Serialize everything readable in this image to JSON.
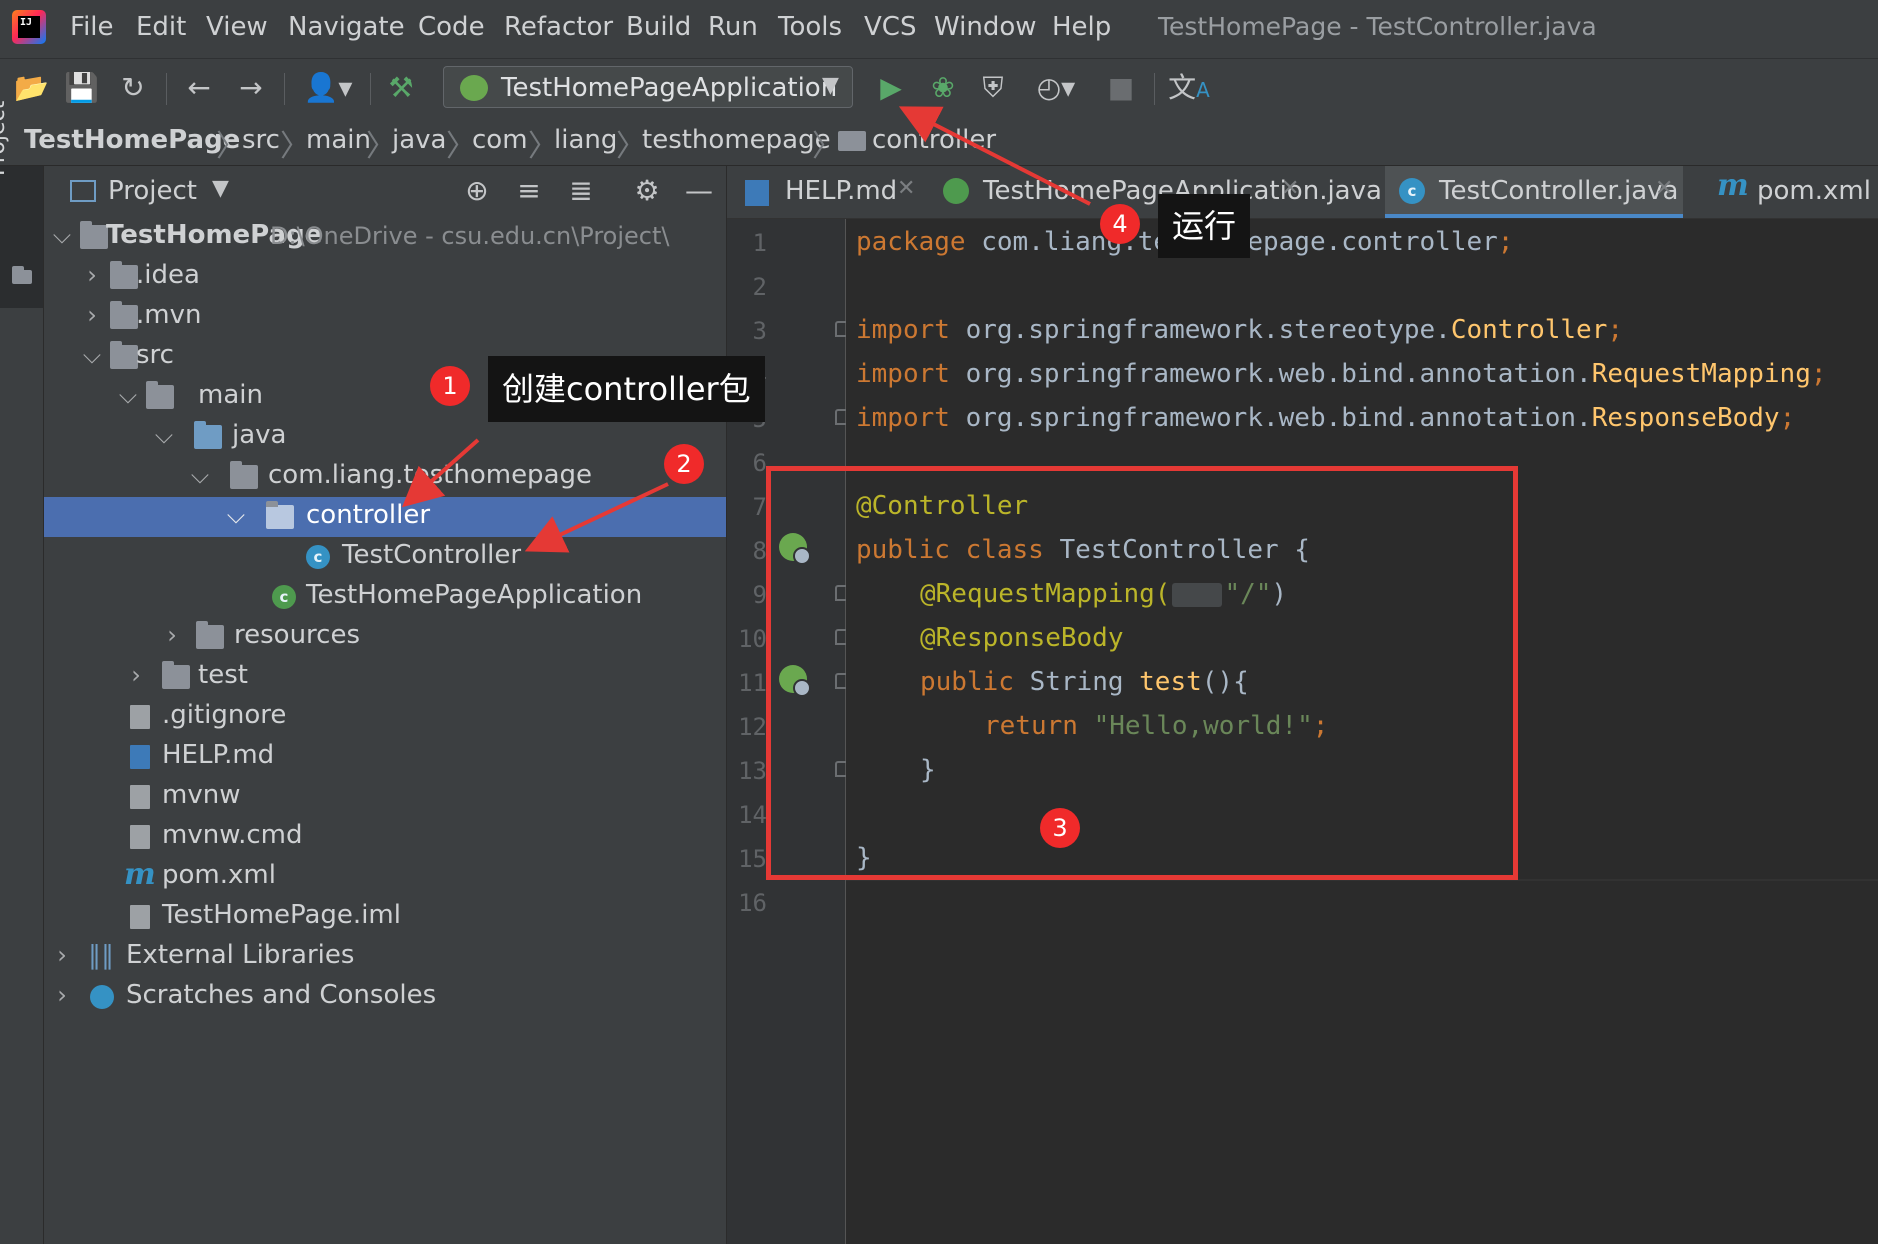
{
  "menubar": {
    "items": [
      "File",
      "Edit",
      "View",
      "Navigate",
      "Code",
      "Refactor",
      "Build",
      "Run",
      "Tools",
      "VCS",
      "Window",
      "Help"
    ],
    "window_title": "TestHomePage - TestController.java"
  },
  "toolbar": {
    "run_config": "TestHomePageApplication",
    "icons": [
      "open-icon",
      "save-icon",
      "sync-icon",
      "back-icon",
      "forward-icon",
      "vcs-user-icon",
      "build-hammer-icon",
      "run-icon",
      "debug-icon",
      "coverage-icon",
      "profile-icon",
      "stop-icon",
      "translate-icon"
    ]
  },
  "breadcrumb": [
    "TestHomePage",
    "src",
    "main",
    "java",
    "com",
    "liang",
    "testhomepage",
    "controller"
  ],
  "left_strip": {
    "project_label": "Project"
  },
  "project_panel": {
    "title": "Project",
    "tree": [
      {
        "label": "TestHomePage",
        "path": "D:\\OneDrive - csu.edu.cn\\Project\\"
      },
      {
        "label": ".idea"
      },
      {
        "label": ".mvn"
      },
      {
        "label": "src"
      },
      {
        "label": "main"
      },
      {
        "label": "java"
      },
      {
        "label": "com.liang.testhomepage"
      },
      {
        "label": "controller"
      },
      {
        "label": "TestController"
      },
      {
        "label": "TestHomePageApplication"
      },
      {
        "label": "resources"
      },
      {
        "label": "test"
      },
      {
        "label": ".gitignore"
      },
      {
        "label": "HELP.md"
      },
      {
        "label": "mvnw"
      },
      {
        "label": "mvnw.cmd"
      },
      {
        "label": "pom.xml"
      },
      {
        "label": "TestHomePage.iml"
      },
      {
        "label": "External Libraries"
      },
      {
        "label": "Scratches and Consoles"
      }
    ]
  },
  "editor_tabs": [
    {
      "label": "HELP.md"
    },
    {
      "label": "TestHomePageApplication.java"
    },
    {
      "label": "TestController.java"
    },
    {
      "label": "pom.xml (T"
    }
  ],
  "editor": {
    "line_numbers": [
      "1",
      "2",
      "3",
      "4",
      "5",
      "6",
      "7",
      "8",
      "9",
      "10",
      "11",
      "12",
      "13",
      "14",
      "15",
      "16"
    ],
    "code": {
      "l1_kw": "package",
      "l1_rest": " com.liang.testhomepage.controller",
      "l3_kw": "import",
      "l3_pkg": " org.springframework.stereotype.",
      "l3_cls": "Controller",
      "l4_kw": "import",
      "l4_pkg": " org.springframework.web.bind.annotation.",
      "l4_cls": "RequestMapping",
      "l5_kw": "import",
      "l5_pkg": " org.springframework.web.bind.annotation.",
      "l5_cls": "ResponseBody",
      "l7_ann": "@Controller",
      "l8_kw": "public class",
      "l8_rest": " TestController {",
      "l9_ann": "@RequestMapping(",
      "l9_str": "\"/\"",
      "l9_end": ")",
      "l10_ann": "@ResponseBody",
      "l11_kw": "public",
      "l11_type": " String ",
      "l11_fn": "test",
      "l11_end": "(){",
      "l12_kw": "return",
      "l12_str": "\"Hello,world!\"",
      "l13": "}",
      "l15": "}",
      "semicolon": ";"
    }
  },
  "annotations": {
    "badge1": "1",
    "callout1": "创建controller包",
    "badge2": "2",
    "badge3": "3",
    "badge4": "4",
    "callout4": "运行"
  }
}
